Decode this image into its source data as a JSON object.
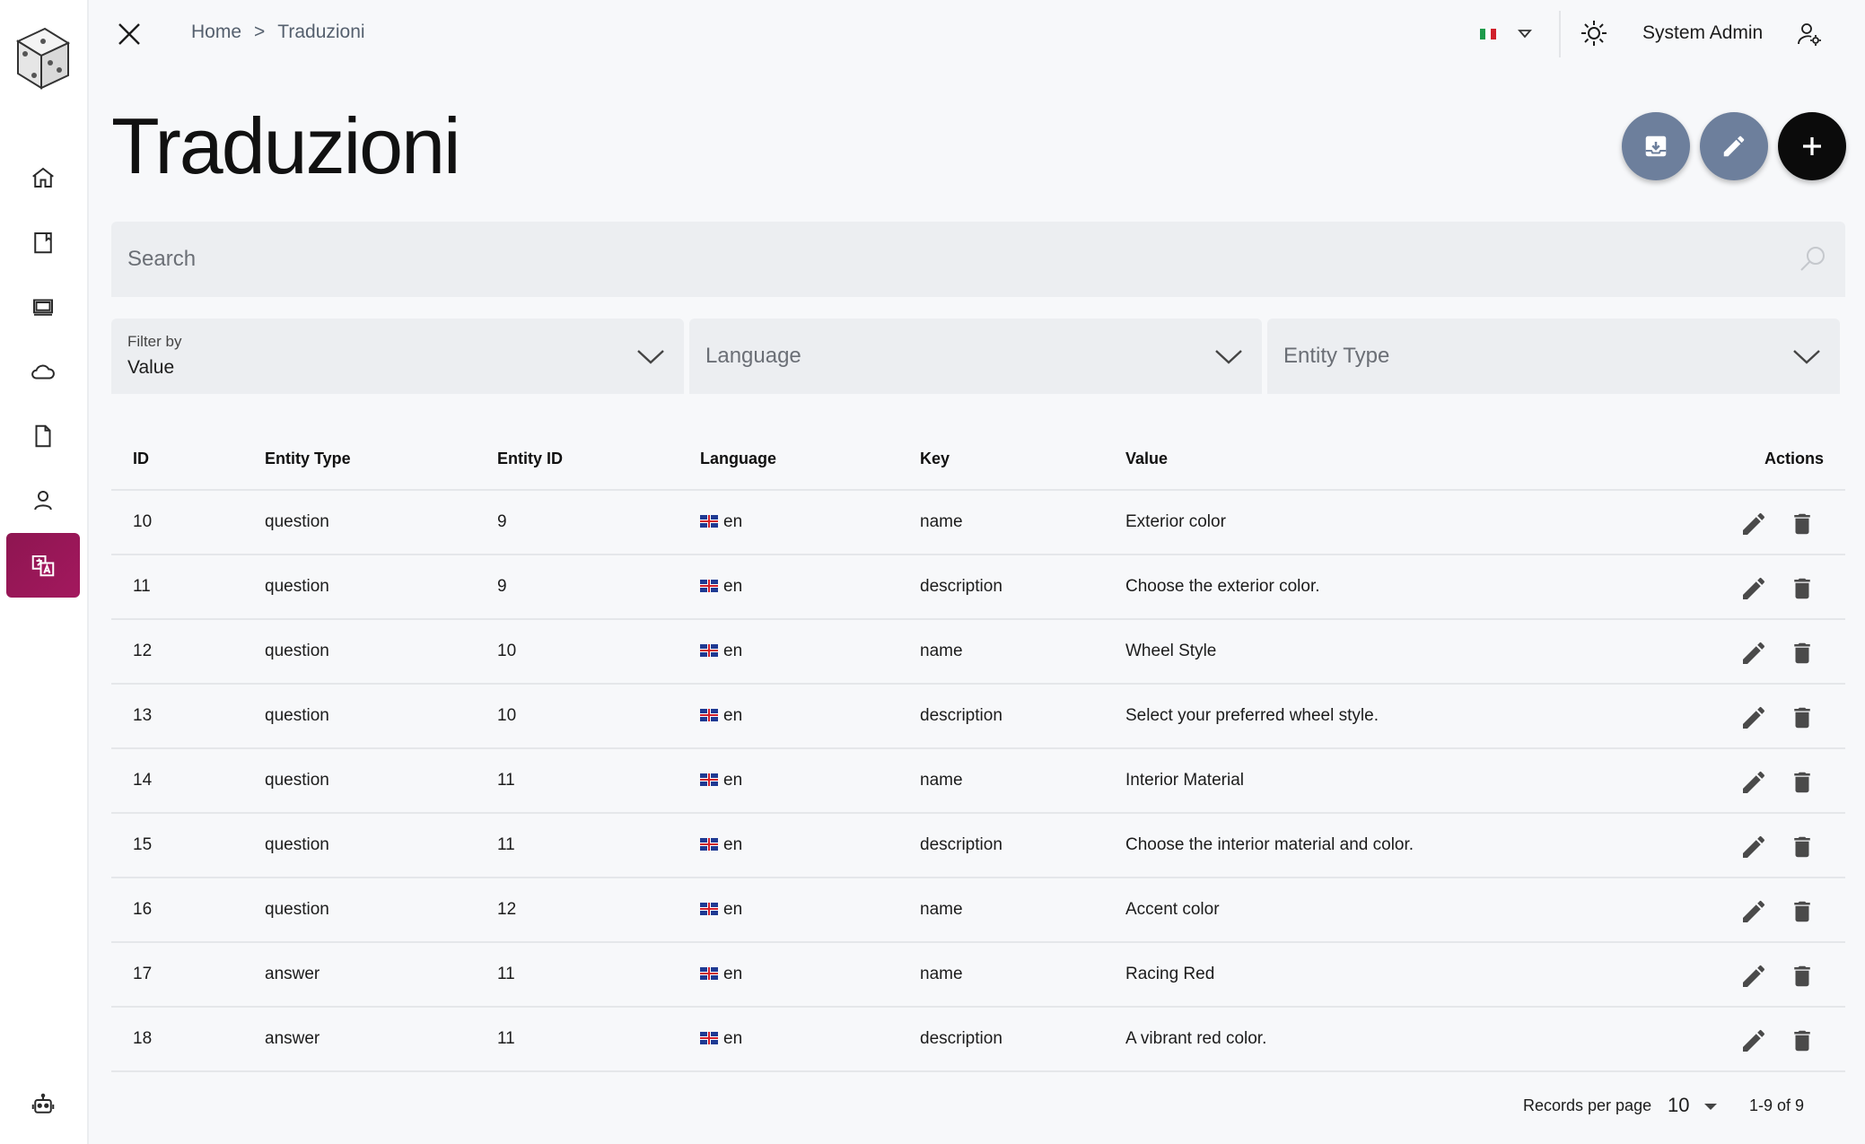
{
  "breadcrumb": {
    "home": "Home",
    "separator": ">",
    "current": "Traduzioni"
  },
  "header": {
    "user_name": "System Admin",
    "language_flag": "italy-flag"
  },
  "page": {
    "title": "Traduzioni"
  },
  "search": {
    "placeholder": "Search"
  },
  "filters": {
    "filter_by_label": "Filter by",
    "filter_by_value": "Value",
    "language_placeholder": "Language",
    "entity_type_placeholder": "Entity Type"
  },
  "table": {
    "columns": [
      "ID",
      "Entity Type",
      "Entity ID",
      "Language",
      "Key",
      "Value",
      "Actions"
    ],
    "rows": [
      {
        "id": "10",
        "entity_type": "question",
        "entity_id": "9",
        "language": "en",
        "key": "name",
        "value": "Exterior color"
      },
      {
        "id": "11",
        "entity_type": "question",
        "entity_id": "9",
        "language": "en",
        "key": "description",
        "value": "Choose the exterior color."
      },
      {
        "id": "12",
        "entity_type": "question",
        "entity_id": "10",
        "language": "en",
        "key": "name",
        "value": "Wheel Style"
      },
      {
        "id": "13",
        "entity_type": "question",
        "entity_id": "10",
        "language": "en",
        "key": "description",
        "value": "Select your preferred wheel style."
      },
      {
        "id": "14",
        "entity_type": "question",
        "entity_id": "11",
        "language": "en",
        "key": "name",
        "value": "Interior Material"
      },
      {
        "id": "15",
        "entity_type": "question",
        "entity_id": "11",
        "language": "en",
        "key": "description",
        "value": "Choose the interior material and color."
      },
      {
        "id": "16",
        "entity_type": "question",
        "entity_id": "12",
        "language": "en",
        "key": "name",
        "value": "Accent color"
      },
      {
        "id": "17",
        "entity_type": "answer",
        "entity_id": "11",
        "language": "en",
        "key": "name",
        "value": "Racing Red"
      },
      {
        "id": "18",
        "entity_type": "answer",
        "entity_id": "11",
        "language": "en",
        "key": "description",
        "value": "A vibrant red color."
      }
    ]
  },
  "pagination": {
    "records_label": "Records per page",
    "per_page": "10",
    "range": "1-9 of 9"
  },
  "colors": {
    "accent": "#9a1757",
    "fab_gray": "#6d7f9c",
    "fab_dark": "#0b0b0b"
  }
}
